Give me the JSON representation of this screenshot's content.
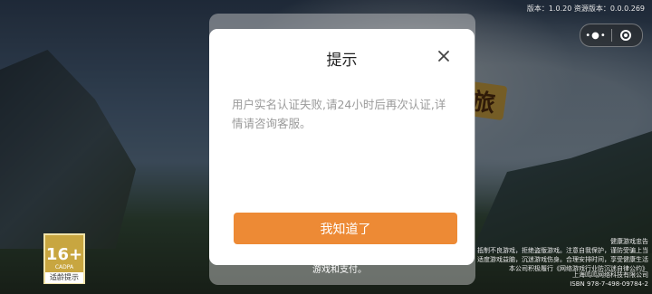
{
  "header": {
    "version_text": "版本：1.0.20 资源版本：0.0.0.269"
  },
  "capsule": {
    "more_icon": "more-dots-icon",
    "close_icon": "target-close-icon"
  },
  "background": {
    "title_art_char": "旅",
    "text_under_modal": "游戏和支付。",
    "age_badge": {
      "rating": "16+",
      "org": "CADPA",
      "tip": "适龄提示"
    },
    "notice_lines": [
      "健康游戏忠告",
      "抵制不良游戏，拒绝盗版游戏。注意自我保护，谨防受骗上当",
      "适度游戏益脑，沉迷游戏伤身。合理安排时间，享受健康生活",
      "本公司积极履行《网络游戏行业防沉迷自律公约》"
    ],
    "footer_lines": [
      "上海鸣鸣网络科技有限公司",
      "ISBN 978-7-498-09784-2"
    ]
  },
  "dialog": {
    "title": "提示",
    "message": "用户实名认证失败,请24小时后再次认证,详情请咨询客服。",
    "confirm_label": "我知道了",
    "close_icon": "close-icon",
    "accent_color": "#ed8a35"
  }
}
